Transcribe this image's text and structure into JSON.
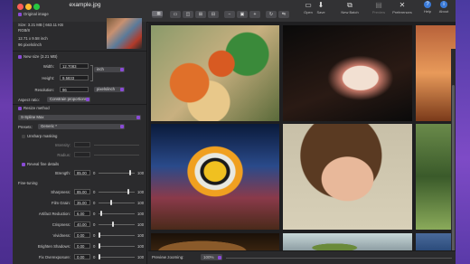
{
  "window": {
    "title": "example.jpg"
  },
  "toolbar": {
    "open": "Open",
    "save": "Save",
    "new_batch": "New Batch",
    "preview": "Preview",
    "preferences": "Preferences",
    "help": "Help",
    "about": "About"
  },
  "panel": {
    "original_image": "Original image",
    "size_info": "Size: 3.21 MB | 663.11 KB",
    "color_mode": "RGB/8",
    "dimensions_cm": "12.71 x 9.58 inch",
    "ppi_info": "96 pixels/inch",
    "new_size": "New size (3.21 MB)",
    "width_label": "Width:",
    "width_value": "12.7083",
    "width_unit": "inch",
    "height_label": "Height:",
    "height_value": "9.5833",
    "resolution_label": "Resolution:",
    "resolution_value": "96",
    "resolution_unit": "pixels/inch",
    "aspect_label": "Aspect ratio:",
    "aspect_value": "Constrain proportions",
    "resize_method": "Resize method",
    "method_value": "S-Spline Max",
    "presets_label": "Presets:",
    "presets_value": "Generic *",
    "unsharp": "Unsharp masking",
    "intensity_label": "Intensity:",
    "radius_label": "Radius:",
    "reveal": "Reveal fine details",
    "strength_label": "Strength:",
    "strength_value": "85.00",
    "finetuning": "Fine-tuning",
    "sliders": [
      {
        "label": "Sharpness:",
        "value": "85.00",
        "min": "0",
        "max": "100"
      },
      {
        "label": "Film Grain:",
        "value": "35.00",
        "min": "0",
        "max": "100"
      },
      {
        "label": "Artifact Reduction:",
        "value": "6.00",
        "min": "0",
        "max": "100"
      },
      {
        "label": "Crispness:",
        "value": "40.00",
        "min": "0",
        "max": "100"
      },
      {
        "label": "Vividness:",
        "value": "0.00",
        "min": "0",
        "max": "100"
      },
      {
        "label": "Brighten Shadows:",
        "value": "0.00",
        "min": "0",
        "max": "100"
      },
      {
        "label": "Fix Overexposure:",
        "value": "0.00",
        "min": "0",
        "max": "100"
      }
    ],
    "strength_min": "0",
    "strength_max": "100"
  },
  "status": {
    "preview_zoom_label": "Preview zooming:",
    "zoom_value": "100%"
  },
  "colors": {
    "accent": "#8a4bd6",
    "bg_purple": "#6b3fb4",
    "window": "#2a2a2c"
  }
}
